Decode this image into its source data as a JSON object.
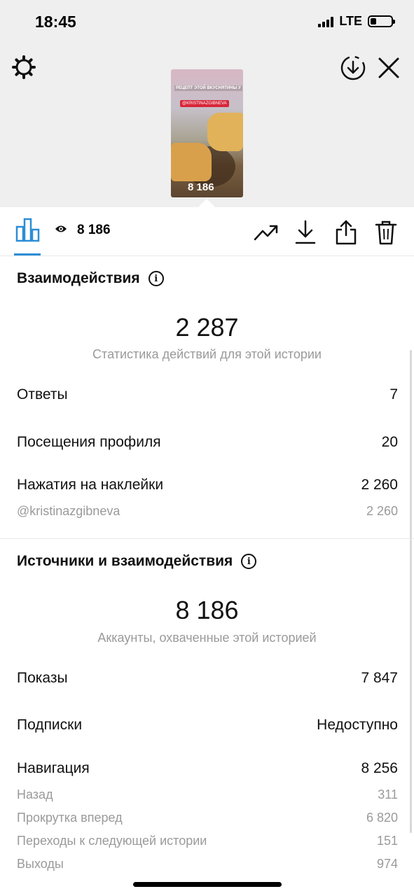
{
  "status": {
    "time": "18:45",
    "network": "LTE"
  },
  "story": {
    "views": "8 186",
    "sticker_text": "@KRISTINAZGIBNEVA",
    "caption": "РЕЦЕПТ ЭТОЙ ВКУСНЯТИНЫ У"
  },
  "interactions": {
    "title": "Взаимодействия",
    "total": "2 287",
    "subtitle": "Статистика действий для этой истории",
    "rows": [
      {
        "label": "Ответы",
        "value": "7"
      },
      {
        "label": "Посещения профиля",
        "value": "20"
      },
      {
        "label": "Нажатия на наклейки",
        "value": "2 260"
      }
    ],
    "sticker_row": {
      "label": "@kristinazgibneva",
      "value": "2 260"
    }
  },
  "discovery": {
    "title": "Источники и взаимодействия",
    "total": "8 186",
    "subtitle": "Аккаунты, охваченные этой историей",
    "rows": [
      {
        "label": "Показы",
        "value": "7 847"
      },
      {
        "label": "Подписки",
        "value": "Недоступно"
      },
      {
        "label": "Навигация",
        "value": "8 256"
      }
    ],
    "nav_rows": [
      {
        "label": "Назад",
        "value": "311"
      },
      {
        "label": "Прокрутка вперед",
        "value": "6 820"
      },
      {
        "label": "Переходы к следующей истории",
        "value": "151"
      },
      {
        "label": "Выходы",
        "value": "974"
      }
    ]
  },
  "colors": {
    "accent": "#2b8ed6",
    "muted": "#9a9a9a"
  },
  "icons": [
    "gear-icon",
    "download-circle-icon",
    "close-icon",
    "bar-chart-icon",
    "eye-icon",
    "trend-icon",
    "download-icon",
    "share-icon",
    "trash-icon",
    "info-icon"
  ]
}
